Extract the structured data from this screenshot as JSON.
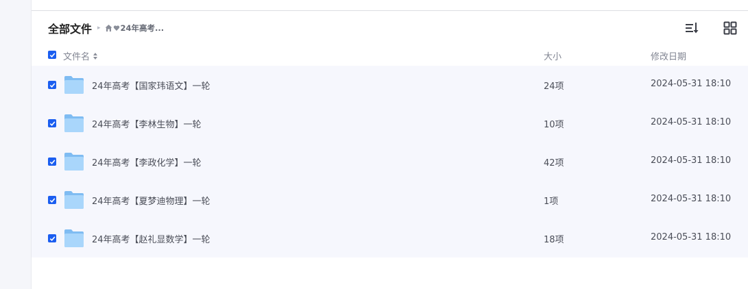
{
  "breadcrumb": {
    "root": "全部文件",
    "current": "24年高考..."
  },
  "toolbar": {
    "sort_icon": "sort-descending-icon",
    "view_icon": "grid-view-icon"
  },
  "columns": {
    "name": "文件名",
    "size": "大小",
    "modified": "修改日期"
  },
  "files": [
    {
      "name": "24年高考【国家玮语文】一轮",
      "size": "24项",
      "modified": "2024-05-31 18:10",
      "checked": true
    },
    {
      "name": "24年高考【李林生物】一轮",
      "size": "10项",
      "modified": "2024-05-31 18:10",
      "checked": true
    },
    {
      "name": "24年高考【李政化学】一轮",
      "size": "42项",
      "modified": "2024-05-31 18:10",
      "checked": true
    },
    {
      "name": "24年高考【夏梦迪物理】一轮",
      "size": "1项",
      "modified": "2024-05-31 18:10",
      "checked": true
    },
    {
      "name": "24年高考【赵礼显数学】一轮",
      "size": "18项",
      "modified": "2024-05-31 18:10",
      "checked": true
    }
  ],
  "colors": {
    "accent": "#1b5ef0",
    "row_bg": "#f6f7fd",
    "folder": "#8ec8f7"
  }
}
